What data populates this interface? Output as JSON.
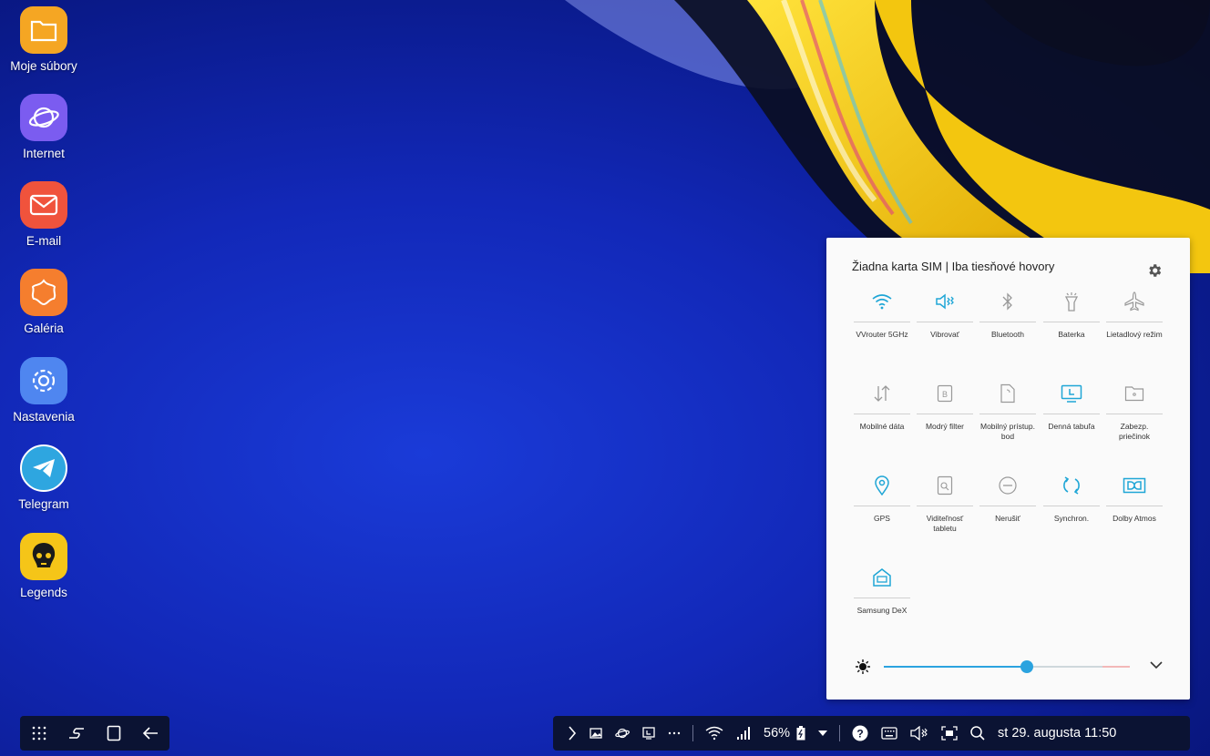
{
  "desktop": {
    "icons": [
      {
        "label": "Moje súbory",
        "icon": "folder-icon",
        "color": "#f5a623"
      },
      {
        "label": "Internet",
        "icon": "planet-icon",
        "color": "#7b5cf0"
      },
      {
        "label": "E-mail",
        "icon": "mail-icon",
        "color": "#f0533c"
      },
      {
        "label": "Galéria",
        "icon": "flower-icon",
        "color": "#f57e2e"
      },
      {
        "label": "Nastavenia",
        "icon": "gear-icon",
        "color": "#4f86f0"
      },
      {
        "label": "Telegram",
        "icon": "paper-plane-icon",
        "color": "#2ea6e0"
      },
      {
        "label": "Legends",
        "icon": "skull-icon",
        "color": "#f5c518"
      }
    ]
  },
  "quick_panel": {
    "header": "Žiadna karta SIM | Iba tiesňové hovory",
    "accent": "#1fa6d6",
    "tiles": [
      {
        "label": "VVrouter 5GHz",
        "icon": "wifi-icon",
        "active": true
      },
      {
        "label": "Vibrovať",
        "icon": "vibrate-icon",
        "active": true
      },
      {
        "label": "Bluetooth",
        "icon": "bluetooth-icon",
        "active": false
      },
      {
        "label": "Baterka",
        "icon": "flashlight-icon",
        "active": false
      },
      {
        "label": "Lietadlový režim",
        "icon": "airplane-icon",
        "active": false
      },
      {
        "label": "Mobilné dáta",
        "icon": "mobile-data-icon",
        "active": false
      },
      {
        "label": "Modrý filter",
        "icon": "blue-filter-icon",
        "active": false
      },
      {
        "label": "Mobilný prístup. bod",
        "icon": "hotspot-icon",
        "active": false
      },
      {
        "label": "Denná tabuľa",
        "icon": "daily-board-icon",
        "active": true
      },
      {
        "label": "Zabezp. priečinok",
        "icon": "secure-folder-icon",
        "active": false
      },
      {
        "label": "GPS",
        "icon": "location-icon",
        "active": true
      },
      {
        "label": "Viditeľnosť tabletu",
        "icon": "tablet-visibility-icon",
        "active": false
      },
      {
        "label": "Nerušiť",
        "icon": "do-not-disturb-icon",
        "active": false
      },
      {
        "label": "Synchron.",
        "icon": "sync-icon",
        "active": true
      },
      {
        "label": "Dolby Atmos",
        "icon": "dolby-icon",
        "active": true
      },
      {
        "label": "Samsung DeX",
        "icon": "dex-icon",
        "active": true
      }
    ],
    "brightness": 0.58
  },
  "taskbar": {
    "battery": "56%",
    "datetime": "st 29. augusta 11:50",
    "help": "?"
  }
}
